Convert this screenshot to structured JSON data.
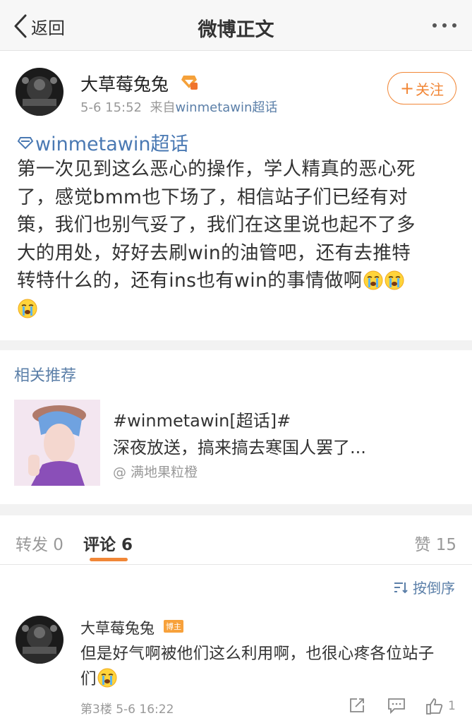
{
  "navbar": {
    "back_label": "返回",
    "title": "微博正文"
  },
  "post": {
    "author": "大草莓兔兔",
    "time": "5-6 15:52",
    "source_prefix": "来自",
    "source_link": "winmetawin超话",
    "follow_label": "关注",
    "topic": "winmetawin超话",
    "lines": [
      "第一次见到这么恶心的操作，学人精真的恶心死",
      "了，感觉bmm也下场了，相信站子们已经有对",
      "策，我们也别气妥了，我们在这里说也起不了多",
      "大的用处，好好去刷win的油管吧，还有去推特",
      "转特什么的，还有ins也有win的事情做啊"
    ]
  },
  "related": {
    "header": "相关推荐",
    "title": "#winmetawin[超话]#",
    "desc": "深夜放送，搞来搞去寒国人罢了...",
    "author": "@ 满地果粒橙"
  },
  "tabs": {
    "repost": "转发 0",
    "comment": "评论 6",
    "like": "赞 15"
  },
  "sort_label": "按倒序",
  "comment": {
    "author": "大草莓兔兔",
    "badge": "博主",
    "lines": [
      "但是好气啊被他们这么利用啊，也很心疼各位站子",
      "们"
    ],
    "meta": "第3楼 5-6 16:22",
    "like_count": "1"
  },
  "colors": {
    "accent": "#f18737",
    "link": "#5b7fa8",
    "topic": "#4a79b3"
  }
}
